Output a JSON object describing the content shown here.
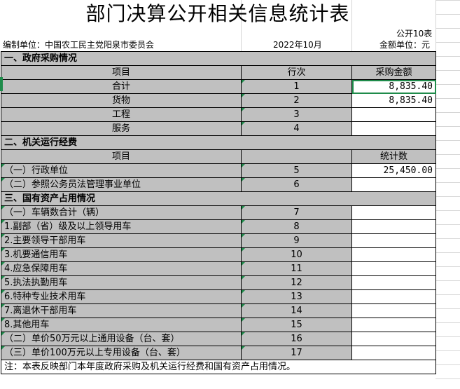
{
  "title": "部门决算公开相关信息统计表",
  "form_code": "公开10表",
  "org_label": "编制单位：中国农工民主党阳泉市委员会",
  "date": "2022年10月",
  "unit_label": "金额单位：元",
  "sections": {
    "procurement": {
      "heading": "一、政府采购情况",
      "col_item": "项目",
      "col_line": "行次",
      "col_amount": "采购金额",
      "rows": [
        {
          "label": "合计",
          "line": "1",
          "amount": "8,835.40"
        },
        {
          "label": "货物",
          "line": "2",
          "amount": "8,835.40"
        },
        {
          "label": "工程",
          "line": "3",
          "amount": ""
        },
        {
          "label": "服务",
          "line": "4",
          "amount": ""
        }
      ]
    },
    "operation": {
      "heading": "二、机关运行经费",
      "col_item": "项目",
      "col_stat": "统计数",
      "rows": [
        {
          "label": "（一）行政单位",
          "line": "5",
          "amount": "25,450.00"
        },
        {
          "label": "（二）参照公务员法管理事业单位",
          "line": "6",
          "amount": ""
        }
      ]
    },
    "assets": {
      "heading": "三、国有资产占用情况",
      "rows": [
        {
          "label": "（一）车辆数合计（辆）",
          "line": "7",
          "amount": ""
        },
        {
          "label": "1.副部（省）级及以上领导用车",
          "line": "8",
          "amount": ""
        },
        {
          "label": "2.主要领导干部用车",
          "line": "9",
          "amount": ""
        },
        {
          "label": "3.机要通信用车",
          "line": "10",
          "amount": ""
        },
        {
          "label": "4.应急保障用车",
          "line": "11",
          "amount": ""
        },
        {
          "label": "5.执法执勤用车",
          "line": "12",
          "amount": ""
        },
        {
          "label": "6.特种专业技术用车",
          "line": "13",
          "amount": ""
        },
        {
          "label": "7.离退休干部用车",
          "line": "14",
          "amount": ""
        },
        {
          "label": "8.其他用车",
          "line": "15",
          "amount": ""
        },
        {
          "label": "（二）单价50万元以上通用设备（台、套）",
          "line": "16",
          "amount": ""
        },
        {
          "label": "（三）单价100万元以上专用设备（台、套）",
          "line": "17",
          "amount": ""
        }
      ]
    }
  },
  "note": "注：本表反映部门本年度政府采购及机关运行经费和国有资产占用情况。",
  "colors": {
    "header_gray": "#c0c0c0",
    "selection_green": "#1e8b4a"
  }
}
